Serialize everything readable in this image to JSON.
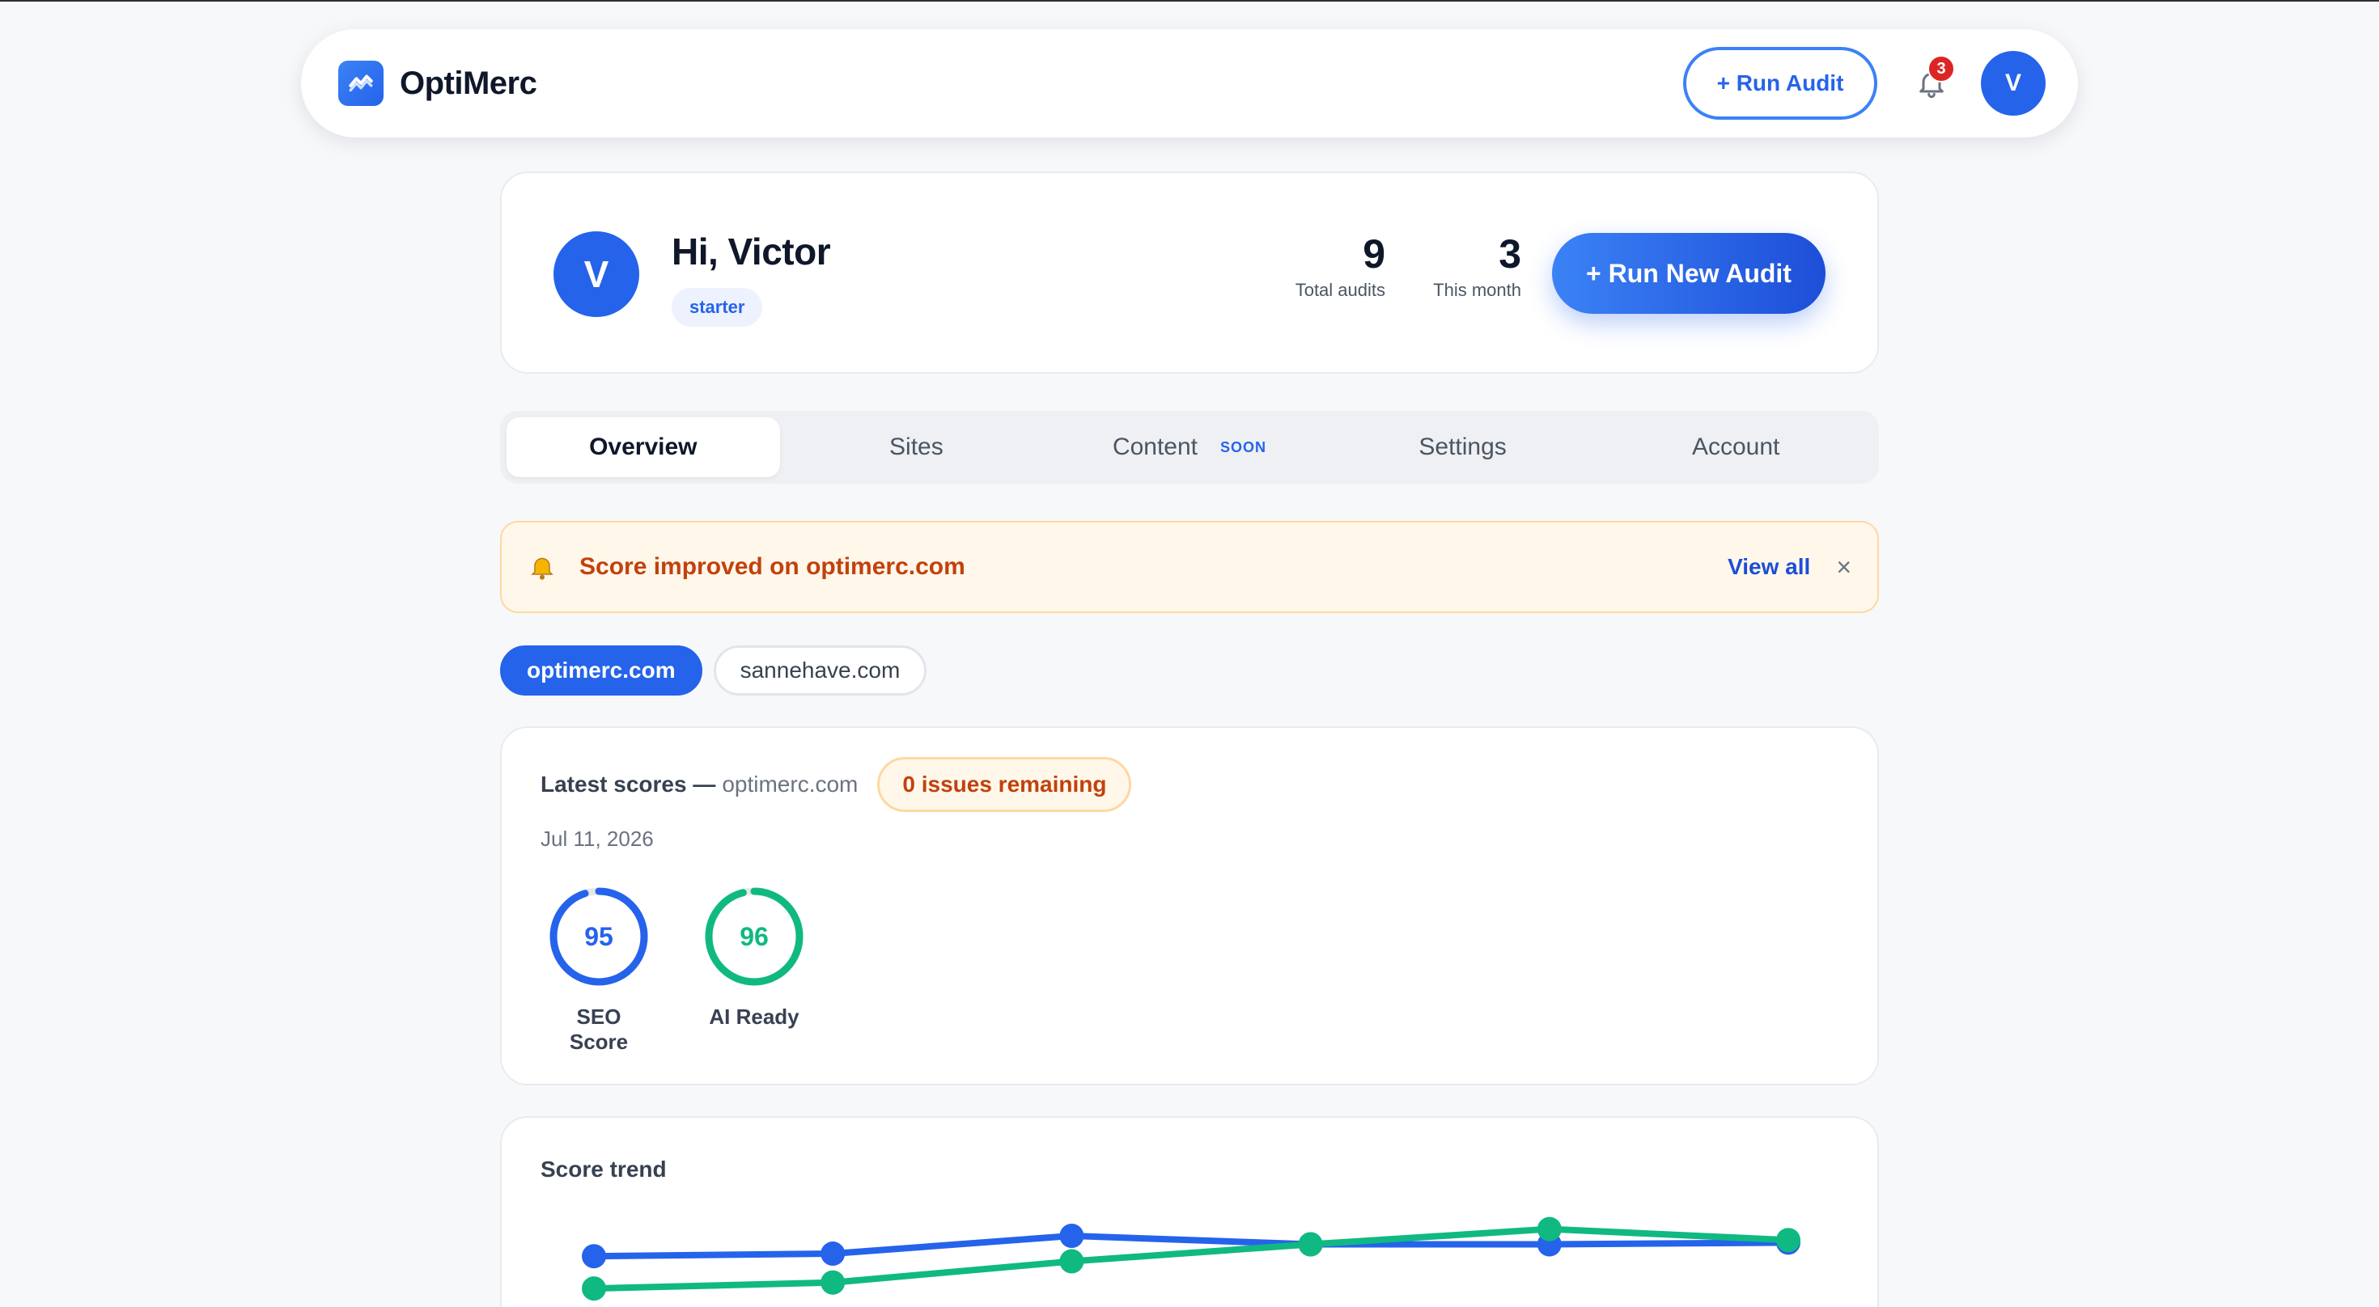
{
  "navbar": {
    "brand": "OptiMerc",
    "run_audit_label": "+ Run Audit",
    "notification_count": "3",
    "avatar_initial": "V"
  },
  "profile": {
    "avatar_initial": "V",
    "greeting": "Hi, Victor",
    "plan": "starter",
    "stats": {
      "total_audits": "9",
      "total_audits_label": "Total audits",
      "this_month": "3",
      "this_month_label": "This month"
    },
    "run_new_audit_label": "+ Run New Audit"
  },
  "tabs": [
    {
      "label": "Overview",
      "active": true
    },
    {
      "label": "Sites"
    },
    {
      "label": "Content",
      "badge": "SOON"
    },
    {
      "label": "Settings"
    },
    {
      "label": "Account"
    }
  ],
  "alert": {
    "icon": "bell-icon",
    "text": "Score improved on optimerc.com",
    "view_all": "View all",
    "close": "×"
  },
  "sites": [
    {
      "label": "optimerc.com",
      "active": true
    },
    {
      "label": "sannehave.com"
    }
  ],
  "scores": {
    "title": "Latest scores —",
    "site": "optimerc.com",
    "issues": "0 issues remaining",
    "date": "Jul 11, 2026",
    "gauges": [
      {
        "value": 95,
        "label": "SEO Score",
        "color": "#2563eb"
      },
      {
        "value": 96,
        "label": "AI Ready",
        "color": "#10b981"
      }
    ]
  },
  "trend": {
    "title": "Score trend"
  },
  "chart_data": {
    "type": "line",
    "x": [
      1,
      2,
      3,
      4,
      5,
      6
    ],
    "ylim": [
      0,
      100
    ],
    "series": [
      {
        "color": "#2563eb",
        "values": [
          93.6,
          93.9,
          96.0,
          95.0,
          95.0,
          95.2
        ]
      },
      {
        "color": "#10b981",
        "values": [
          89.8,
          90.5,
          93.0,
          95.0,
          96.8,
          95.5
        ]
      }
    ]
  }
}
